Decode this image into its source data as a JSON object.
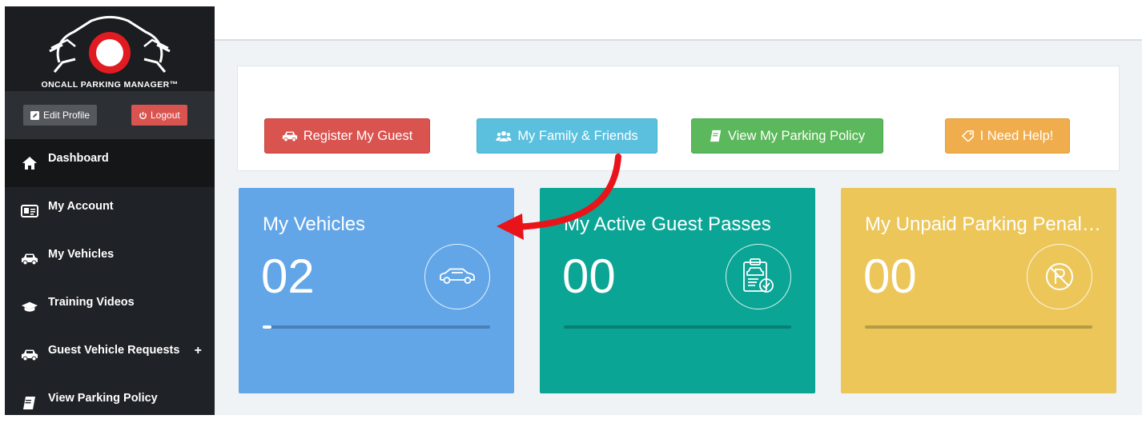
{
  "brand": {
    "name": "ONCALL PARKING MANAGER™"
  },
  "profile": {
    "edit_label": "Edit Profile",
    "logout_label": "Logout"
  },
  "nav": {
    "items": [
      {
        "label": "Dashboard",
        "icon": "home-icon"
      },
      {
        "label": "My Account",
        "icon": "id-card-icon"
      },
      {
        "label": "My Vehicles",
        "icon": "car-icon"
      },
      {
        "label": "Training Videos",
        "icon": "graduation-cap-icon"
      },
      {
        "label": "Guest Vehicle Requests",
        "icon": "car-icon",
        "expand": "+"
      },
      {
        "label": "View Parking Policy",
        "icon": "book-icon"
      }
    ]
  },
  "actions": {
    "register_guest": "Register My Guest",
    "family_friends": "My Family & Friends",
    "parking_policy": "View My Parking Policy",
    "help": "I Need Help!"
  },
  "cards": [
    {
      "title": "My Vehicles",
      "count": "02",
      "icon": "car-outline-icon",
      "progress": 0.04
    },
    {
      "title": "My Active Guest Passes",
      "count": "00",
      "icon": "clipboard-check-icon",
      "progress": 0
    },
    {
      "title": "My Unpaid Parking Penalties",
      "count": "00",
      "icon": "no-parking-icon",
      "progress": 0
    }
  ],
  "colors": {
    "sidebar": "#1f2226",
    "danger": "#d9534f",
    "info": "#5bc0de",
    "success": "#5cb85c",
    "warning": "#f0ad4e",
    "card_blue": "#62a6e8",
    "card_teal": "#0aa595",
    "card_yellow": "#ecc659",
    "annotation_arrow": "#e8141a"
  }
}
